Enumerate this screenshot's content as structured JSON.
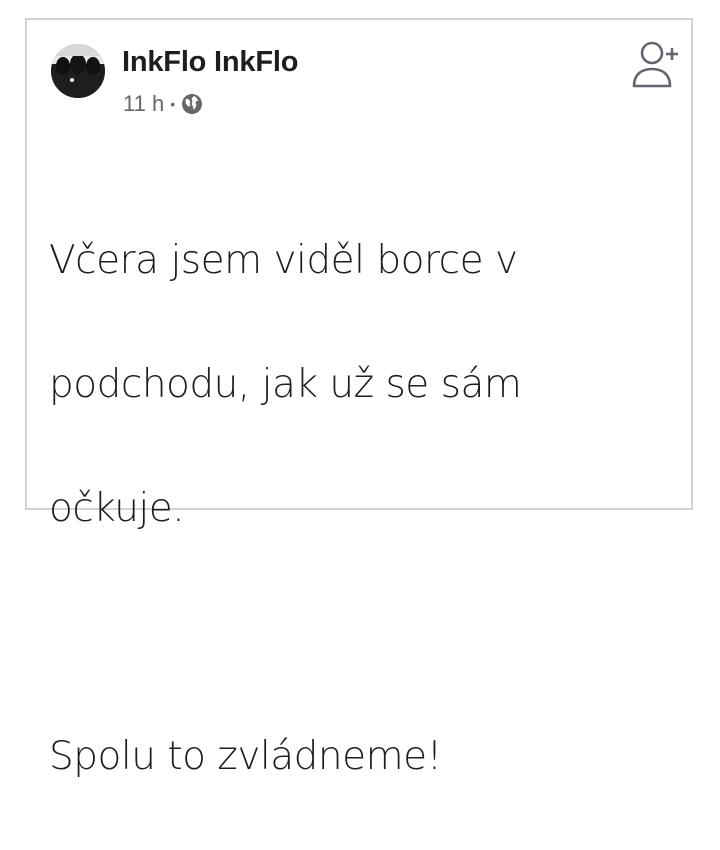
{
  "post": {
    "author": "InkFlo InkFlo",
    "time": "11 h",
    "separator": "•",
    "privacy_icon": "globe-icon",
    "add_friend_icon": "add-friend-icon",
    "text_lines": [
      "Včera jsem viděl borce v",
      "podchodu, jak už se sám",
      "očkuje."
    ],
    "text_line_2": "Spolu to zvládneme!"
  },
  "colors": {
    "text": "#1c1e21",
    "meta": "#65676b",
    "border": "#d3d3d3"
  }
}
